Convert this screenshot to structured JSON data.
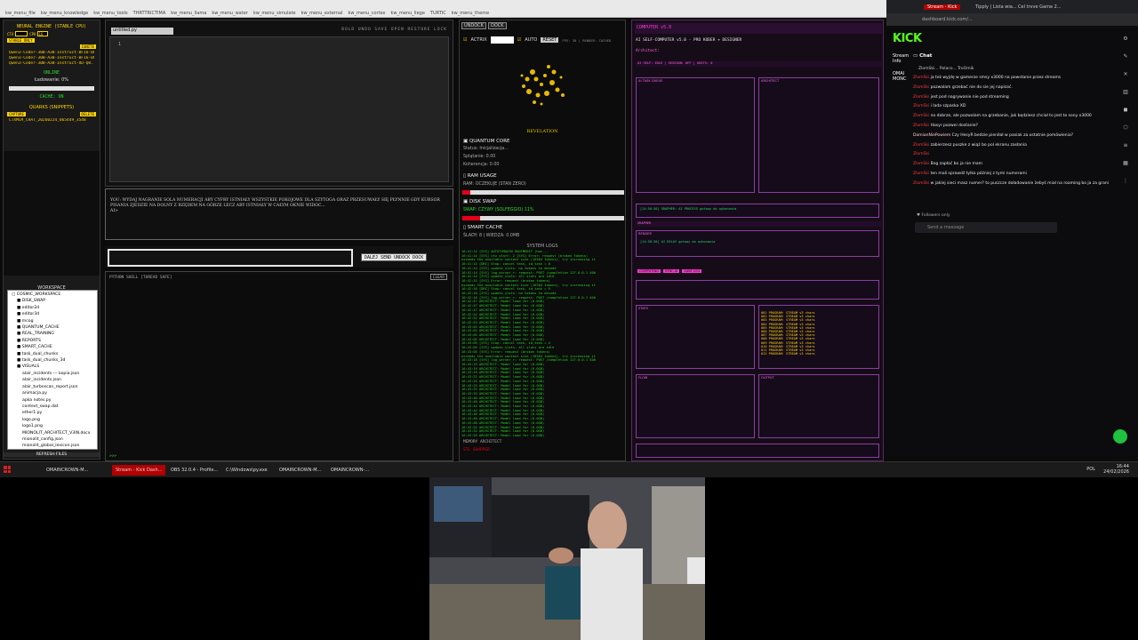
{
  "topbar": {
    "tabs": [
      "kw_menu_file",
      "kw_menu_knowledge",
      "kw_menu_tools",
      "THRTTRICTIMA",
      "kw_menu_llama",
      "kw_menu_water",
      "kw_menu_simulate",
      "kw_menu_external",
      "kw_menu_cortex",
      "kw_menu_liege",
      "TURTIC",
      "kw_menu_theme"
    ]
  },
  "left_panel": {
    "title": "NEURAL ENGINE (STABLE CPU)",
    "ctx_label": "CTX",
    "cpu_label": "CPU",
    "cpu_value": "16",
    "stable_badge": "STABLE ONLY",
    "ignite_label": "IGNITE",
    "models": [
      "Qwen3-Coder-30B-A3B-Instruct-BF16-00",
      "Qwen3-Coder-30B-A3B-Instruct-BF16-00",
      "Qwen3-Coder-30B-A3B-Instruct-UD-Q8..."
    ],
    "status_online": "ONLINE",
    "loading_text": "Ładowanie: 0%",
    "cache_status": "CACHE: ON",
    "quarks_title": "QUARKS (SNIPPETS)",
    "capture_label": "CAPTURE",
    "delete_label": "DELETE",
    "snippet": "CTXMCM_CHAT_20260224_065449_3548",
    "workspace_title": "WORKSPACE",
    "tree": [
      "▢ COSMIC_WORKSPACE",
      "■ DISK_SWAP",
      "■ editor2d",
      "■ editor3d",
      "■ mcog",
      "■ QUANTUM_CACHE",
      "■ REAL_TRAINING",
      "■ REPORTS",
      "■ SMART_CACHE",
      "■ task_dual_chunks",
      "■ task_dual_chunks_3d",
      "■ VISUALS",
      "alair_incidents --- kopia.json",
      "alair_incidents.json",
      "alair_turboscan_report.json",
      "animacja.py",
      "apka notes.py",
      "context_swap.dat",
      "ether1.py",
      "logo.png",
      "logo1.png",
      "MIONOLIT_ARCHITECT_V3IN.docx",
      "mionolit_config.json",
      "mionolit_global_lexicon.json"
    ],
    "refresh_label": "REFRESH FILES"
  },
  "editor": {
    "tab_label": "untitled.py",
    "tools": "BOLD   UNDO   SAVE   OPEN   RESTORE   LOCK",
    "line_number": "1"
  },
  "console": {
    "text": "YOU: WYDAJ NAGRANIE SOLA NUMERACJI ABY CYFRY ISTNIAŁY WSZYSTKIE POKOJOWE DLA SZYTOGA ORAZ PRZESUWAŁY SIĘ PŁYNNIE GDY KURSOR PISANIA ZJEDZIE NA DOLNY Z RZĘDEM NA GÓRZE LECZ ABY ISTNIAŁY W CAŁYM OKNIE WIDOC...",
    "prompt": "AI>"
  },
  "input_row": {
    "buttons": "DALEJ  SEND  UNDOCK  DOCK"
  },
  "python_shell": {
    "header": "PYTHON SHELL [THREAD SAFE]",
    "clear_label": "CLEAR",
    "prompt": ">>>"
  },
  "mid_panel": {
    "tabs": [
      "UNDOCK",
      "DOCK"
    ],
    "actrix_label": "ACTRIX",
    "auto_label": "AUTO",
    "reset_label": "RESET",
    "fps_text": "FPS: 30 | RENDER: CACHED",
    "revelation": "REVELATION",
    "quantum_title": "QUANTUM CORE",
    "quantum_status": "Status: Inicjalizacja...",
    "quantum_split": "Splątanie: 0.00",
    "quantum_coherence": "Koherencja: 0.00",
    "ram_title": "RAM USAGE",
    "ram_status": "RAM: OCZEKUJE (STAN ZERO)",
    "ram_fill_percent": 5,
    "disk_title": "DISK SWAP",
    "disk_status": "SWAP: CZYWY (SOLFEGGIO) 11%",
    "disk_fill_percent": 11,
    "smart_title": "SMART CACHE",
    "smart_status": "ŚLADY: 8 | WIEDZA: 0.0MB",
    "logs_title": "SYSTEM LOGS",
    "logs": [
      "16:41:14 [SYS] AUTOTYMAGIN ROOTMEDIT (hon...",
      "16:41:14 [SYS] ctx start: 2 [SYS] Error: request (broken tokens)",
      "exceeds the available context size (16384 tokens), try increasing it",
      "16:41:14 [DRI] Stop: cancel task, id_task = 8",
      "16:41:14 [SYS] update_slots: no tokens to decode",
      "16:41:14 [SYS] log_server_r: request: POST /completion 127.0.0.1 400",
      "16:41:14 [SYS] update_slots: all slots are idle",
      "16:42:15 [SYS] Error: request (broken tokens)",
      "exceeds the available context size (16384 tokens), try increasing it",
      "16:42:16 [DRI] Stop: cancel task, id_task = 9",
      "16:42:16 [SYS] update_slots: no tokens to decode",
      "16:42:16 [SYS] log_server_r: request: POST /completion 127.0.0.1 400",
      "16:42:47 ARCHITECT: Model load for (0.0GB)",
      "16:42:47 ARCHITECT: Model load for (0.0GB)",
      "16:42:47 ARCHITECT: Model load for (0.0GB)",
      "16:42:52 ARCHITECT: Model load for (0.0GB)",
      "16:42:52 ARCHITECT: Model load for (0.0GB)",
      "16:42:53 ARCHITECT: Model load for (0.0GB)",
      "16:43:02 ARCHITECT: Model load for (0.0GB)",
      "16:43:02 ARCHITECT: Model load for (0.0GB)",
      "16:43:05 ARCHITECT: Model load for (0.0GB)",
      "16:43:05 ARCHITECT: Model load for (0.0GB)",
      "16:43:05 [SYS] Stop: cancel task, id_task = 4",
      "16:43:05 [SYS] update_slots: all slots are idle",
      "16:43:05 [SYS] Error: request (broken tokens)",
      "exceeds the available context size (16384 tokens), try increasing it",
      "16:43:18 [SYS] log_server_r: request: POST /completion 127.0.0.1 400",
      "16:43:19 ARCHITECT: Model load for (0.0GB)",
      "16:43:19 ARCHITECT: Model load for (0.0GB)",
      "16:43:19 ARCHITECT: Model load for (0.0GB)",
      "16:43:22 ARCHITECT: Model load for (0.0GB)",
      "16:43:25 ARCHITECT: Model load for (0.0GB)",
      "16:43:25 ARCHITECT: Model load for (0.0GB)",
      "16:43:33 ARCHITECT: Model load for (0.0GB)",
      "16:43:33 ARCHITECT: Model load for (0.0GB)",
      "16:43:40 ARCHITECT: Model load for (0.0GB)",
      "16:43:40 ARCHITECT: Model load for (0.0GB)",
      "16:43:44 ARCHITECT: Model load for (0.0GB)",
      "16:43:44 ARCHITECT: Model load for (0.0GB)",
      "16:43:46 ARCHITECT: Model load for (0.0GB)",
      "16:43:48 ARCHITECT: Model load for (0.0GB)",
      "16:43:48 ARCHITECT: Model load for (0.0GB)",
      "16:43:52 ARCHITECT: Model load for (0.0GB)",
      "16:43:52 ARCHITECT: Model load for (0.0GB)",
      "16:43:55 ARCHITECT: Model load for (0.0GB)"
    ],
    "memory_title": "MEMORY ARCHITECT",
    "memory_status": "STL SHAPPED"
  },
  "right_panel": {
    "title": "COMPUTER v5.0",
    "subtitle": "AI SELF-COMPUTER v5.0 - PRO KODER + DESIGNER",
    "architect": "Architect:",
    "status_line": "AI SELF: IDLE | SESSION: OFF | HOSTS: 0",
    "box_labels": [
      "AI TASK QUEUE",
      "ARCHITECT",
      "GRAPHER",
      "RENDER",
      "STATS",
      "FLOW",
      "OUTPUT"
    ],
    "green_lines": [
      "[14:58:30] GRAPHER: AI PROCESS gotowy do wykonania",
      "[14:58:30] AI RELAY gotowy do wykonania"
    ],
    "pink_buttons": [
      "COMPUTING",
      "SYNC AI",
      "SAVE LOG"
    ],
    "stats_lines": [
      "001 PROGRAM: STREAM v3 chars",
      "002 PROGRAM: STREAM v3 chars",
      "003 PROGRAM: STREAM v3 chars",
      "004 PROGRAM: STREAM v3 chars",
      "005 PROGRAM: STREAM v3 chars",
      "006 PROGRAM: STREAM v3 chars",
      "007 PROGRAM: STREAM v3 chars",
      "008 PROGRAM: STREAM v3 chars",
      "009 PROGRAM: STREAM v3 chars",
      "010 PROGRAM: STREAM v3 chars",
      "011 PROGRAM: STREAM v3 chars",
      "012 PROGRAM: STREAM v3 chars"
    ]
  },
  "chat": {
    "browser_tabs": [
      "Stream - Kick",
      "Tipply | Lista wia...",
      "Cel trvve Game 2..."
    ],
    "url": "dashboard.kick.com/...",
    "logo": "KICK",
    "side_labels": [
      "Stream",
      "Info",
      "OMAI",
      "MONC"
    ],
    "header": "Chat",
    "pinned": "ZlomSki...   Polaco...   TroOmik",
    "lines": [
      {
        "user": "ZlomSki",
        "text": "ja też wyjdę w gamerze smsy x3000 na powstanie przez streams"
      },
      {
        "user": "ZlomSki",
        "text": "pozwalam grzebać nie do sie jej napisać."
      },
      {
        "user": "ZlomSki",
        "text": "jest pod nagrywanie nie pod streaming"
      },
      {
        "user": "ZlomSki",
        "text": "i lada szpaska XD"
      },
      {
        "user": "ZlomSki",
        "text": "no dobrze, ale pozwalam na grzebanie, jak będziesz chciał to jest to sony x3000"
      },
      {
        "user": "ZlomSki",
        "text": "Hasyr pozwei dostanie?"
      },
      {
        "user": "DamianNiePowiem",
        "text": "Czy HesyR bedzie pieniłał w pasiak za ostatnie pomówienia?"
      },
      {
        "user": "ZlomSki",
        "text": "zabierzesz puszke z wiąż bo pol ekranu zasłania"
      },
      {
        "user": "ZlomSki",
        "text": ""
      },
      {
        "user": "ZlomSki",
        "text": "Bog zapłać bo ja nie mam"
      },
      {
        "user": "ZlomSki",
        "text": "ten mali sprawdź tylko później z tymi numerami"
      },
      {
        "user": "ZlomSki",
        "text": "w jakiej sieci masz numer? to puszcze doładowanie żebyś miał na roaming bo ja za granicą..."
      }
    ],
    "followers": "Followers only",
    "send_placeholder": "Send a message"
  },
  "taskbar": {
    "items": [
      "OMAINCROWN-M...",
      "Stream - Kick Dash...",
      "OBS 32.0.4 - Profile...",
      "C:\\Windows\\py.exe",
      "OMAINCROWN-M...",
      "OMAINCROWN-..."
    ],
    "lang": "POL",
    "time": "16:44",
    "date": "24/02/2026"
  },
  "colors": {
    "accent_yellow": "#ffd400",
    "accent_red": "#e3001b",
    "terminal_green": "#21d321",
    "neon_pink": "#ff3ad1",
    "kick_green": "#53fc18"
  }
}
